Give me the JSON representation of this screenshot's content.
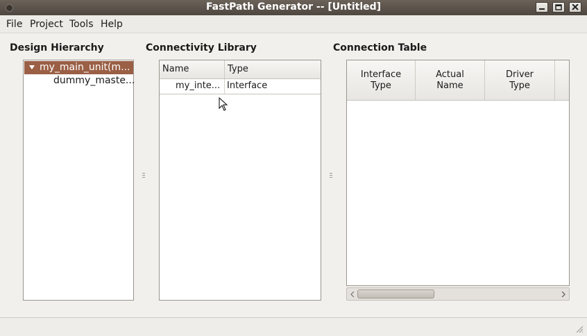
{
  "window": {
    "title": "FastPath Generator -- [Untitled]"
  },
  "menu": {
    "items": [
      "File",
      "Project",
      "Tools",
      "Help"
    ]
  },
  "design_hierarchy": {
    "heading": "Design Hierarchy",
    "selected_item": "my_main_unit(m...",
    "child_item": "dummy_maste..."
  },
  "connectivity_library": {
    "heading": "Connectivity Library",
    "columns": [
      "Name",
      "Type"
    ],
    "rows": [
      {
        "name": "my_inte...",
        "type": "Interface"
      }
    ]
  },
  "connection_table": {
    "heading": "Connection Table",
    "columns": [
      {
        "line1": "Interface",
        "line2": "Type"
      },
      {
        "line1": "Actual",
        "line2": "Name"
      },
      {
        "line1": "Driver",
        "line2": "Type"
      }
    ]
  },
  "colors": {
    "titlebar": "#5a524a",
    "selection": "#9a5f45",
    "background": "#f2f0ec"
  }
}
